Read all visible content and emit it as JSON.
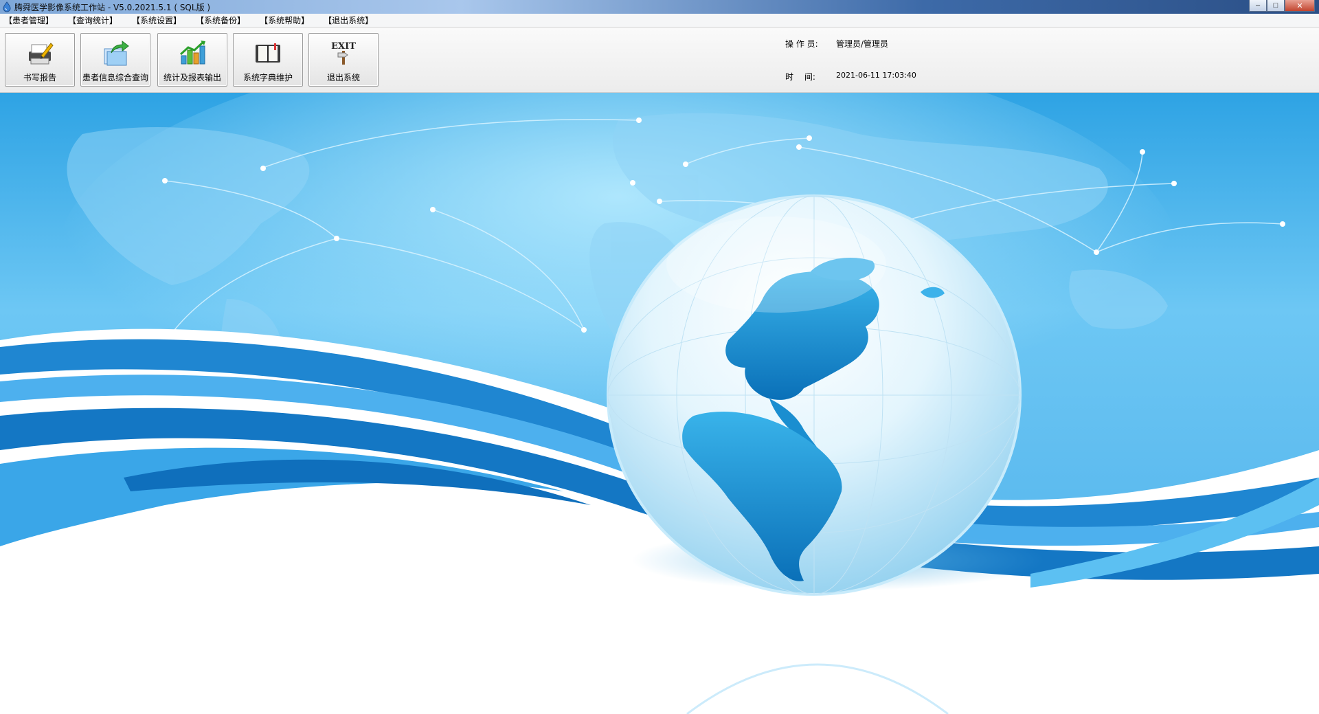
{
  "window": {
    "title": "腾舜医学影像系统工作站 - V5.0.2021.5.1 ( SQL版 )",
    "buttons": {
      "minimize": "–",
      "maximize": "□",
      "close": "✕"
    }
  },
  "menu": [
    "【患者管理】",
    "【查询统计】",
    "【系统设置】",
    "【系统备份】",
    "【系统帮助】",
    "【退出系统】"
  ],
  "toolbar": [
    {
      "label": "书写报告",
      "icon": "printer-pen-icon"
    },
    {
      "label": "患者信息综合查询",
      "icon": "share-arrow-icon"
    },
    {
      "label": "统计及报表输出",
      "icon": "bar-chart-icon"
    },
    {
      "label": "系统字典维护",
      "icon": "book-icon"
    },
    {
      "label": "退出系统",
      "icon": "exit-sign-icon",
      "icon_text": "EXIT"
    }
  ],
  "info": {
    "operator_label": "操 作 员:",
    "operator_value": "管理员/管理员",
    "time_label": "时　 间:",
    "time_value": "2021-06-11 17:03:40"
  },
  "colors": {
    "sky_top": "#2ea3e4",
    "sky_light": "#7dd0f7",
    "wave_dark": "#1477c4",
    "wave_mid": "#3aa6e8",
    "globe_land": "#1c8fd0"
  }
}
